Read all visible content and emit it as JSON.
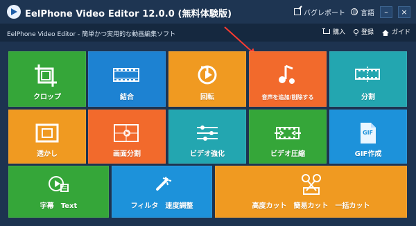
{
  "window": {
    "title": "EelPhone Video Editor 12.0.0 (無料体験版)",
    "tagline": "EelPhone Video Editor - 簡単かつ実用的な動画編集ソフト"
  },
  "titlebar": {
    "feedback": "バグレポート",
    "language": "言語",
    "minimize": "–",
    "close": "×"
  },
  "subbar": {
    "buy": "購入",
    "register": "登録",
    "guide": "ガイド"
  },
  "tiles": [
    {
      "id": "crop",
      "label": "クロップ",
      "color": "#35a639",
      "icon": "crop-icon"
    },
    {
      "id": "merge",
      "label": "結合",
      "color": "#1d82d2",
      "icon": "filmstrip-icon"
    },
    {
      "id": "rotate",
      "label": "回転",
      "color": "#f09a21",
      "icon": "rotate-icon"
    },
    {
      "id": "audio",
      "label": "音声を追加/削除する",
      "color": "#f26a2c",
      "icon": "music-note-icon"
    },
    {
      "id": "split",
      "label": "分割",
      "color": "#23a6b0",
      "icon": "cut-film-icon"
    },
    {
      "id": "watermark",
      "label": "透かし",
      "color": "#f09a21",
      "icon": "watermark-icon"
    },
    {
      "id": "screen-split",
      "label": "画面分割",
      "color": "#f26a2c",
      "icon": "split-screen-icon"
    },
    {
      "id": "enhance",
      "label": "ビデオ強化",
      "color": "#23a6b0",
      "icon": "sliders-icon"
    },
    {
      "id": "compress",
      "label": "ビデオ圧縮",
      "color": "#35a639",
      "icon": "compress-icon"
    },
    {
      "id": "gif",
      "label": "GIF作成",
      "color": "#1d92da",
      "icon": "gif-icon"
    },
    {
      "id": "subtitle",
      "label": "字幕　Text",
      "color": "#35a639",
      "icon": "subtitle-icon"
    },
    {
      "id": "filter",
      "label": "フィルタ　速度調整",
      "color": "#1d92da",
      "icon": "magic-wand-icon"
    },
    {
      "id": "crop-advanced",
      "label": "高度カット　簡易カット　一括カット",
      "color": "#f09a21",
      "icon": "scissors-icon"
    }
  ]
}
